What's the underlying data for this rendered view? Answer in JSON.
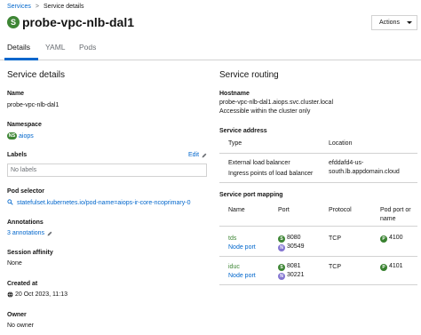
{
  "breadcrumb": {
    "parent": "Services",
    "separator": ">",
    "current": "Service details"
  },
  "header": {
    "badge": "S",
    "title": "probe-vpc-nlb-dal1",
    "actions_label": "Actions"
  },
  "tabs": [
    {
      "label": "Details"
    },
    {
      "label": "YAML"
    },
    {
      "label": "Pods"
    }
  ],
  "details": {
    "heading": "Service details",
    "name_label": "Name",
    "name_value": "probe-vpc-nlb-dal1",
    "namespace_label": "Namespace",
    "namespace_badge": "NS",
    "namespace_value": "aiops",
    "labels_label": "Labels",
    "labels_edit": "Edit",
    "labels_value": "No labels",
    "pod_selector_label": "Pod selector",
    "pod_selector_value": "statefulset.kubernetes.io/pod-name=aiops-ir-core-ncoprimary-0",
    "annotations_label": "Annotations",
    "annotations_value": "3 annotations",
    "session_affinity_label": "Session affinity",
    "session_affinity_value": "None",
    "created_label": "Created at",
    "created_value": "20 Oct 2023, 11:13",
    "owner_label": "Owner",
    "owner_value": "No owner"
  },
  "routing": {
    "heading": "Service routing",
    "hostname_label": "Hostname",
    "hostname_value": "probe-vpc-nlb-dal1.aiops.svc.cluster.local",
    "hostname_note": "Accessible within the cluster only",
    "address_label": "Service address",
    "address_cols": {
      "type": "Type",
      "location": "Location"
    },
    "address_rows": [
      {
        "type": "External load balancer",
        "location_line1": "efddafd4-us-",
        "location_line2": "south.lb.appdomain.cloud"
      },
      {
        "type": "Ingress points of load balancer",
        "location_line1": "",
        "location_line2": ""
      }
    ],
    "port_label": "Service port mapping",
    "port_cols": {
      "name": "Name",
      "port": "Port",
      "protocol": "Protocol",
      "pod_port_line1": "Pod port or",
      "pod_port_line2": "name"
    },
    "port_rows": [
      {
        "name": "tds",
        "node_port_label": "Node port",
        "service_badge": "S",
        "service_port": "8080",
        "node_badge": "N",
        "node_port": "30549",
        "protocol": "TCP",
        "pod_badge": "P",
        "pod_port": "4100"
      },
      {
        "name": "iduc",
        "node_port_label": "Node port",
        "service_badge": "S",
        "service_port": "8081",
        "node_badge": "N",
        "node_port": "30221",
        "protocol": "TCP",
        "pod_badge": "P",
        "pod_port": "4101"
      }
    ]
  }
}
